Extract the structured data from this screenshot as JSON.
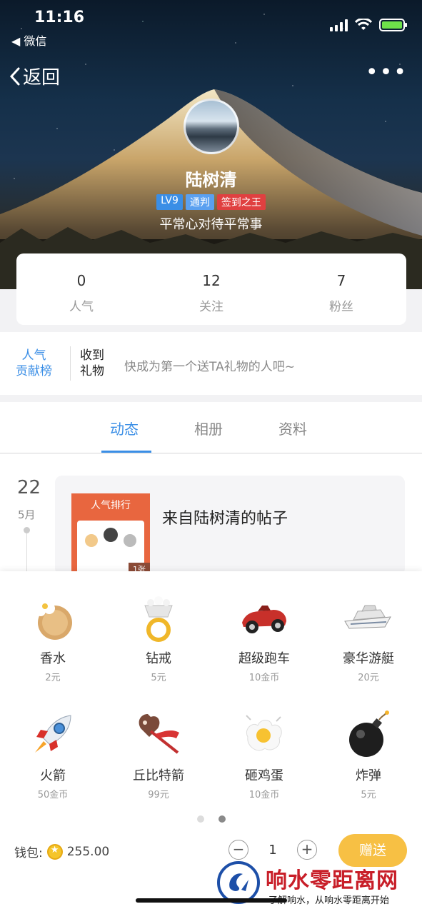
{
  "status": {
    "time": "11:16",
    "back_app": "◀ 微信"
  },
  "nav": {
    "back_label": "返回",
    "more_icon": "more-dots-icon"
  },
  "profile": {
    "name": "陆树清",
    "badges": [
      {
        "text": "LV9",
        "color": "#3a8ee6"
      },
      {
        "text": "通判",
        "color": "#5aa0f0"
      },
      {
        "text": "签到之王",
        "color": "#e04040"
      }
    ],
    "motto": "平常心对待平常事"
  },
  "stats": [
    {
      "value": "0",
      "label": "人气"
    },
    {
      "value": "12",
      "label": "关注"
    },
    {
      "value": "7",
      "label": "粉丝"
    }
  ],
  "gift_strip": {
    "rank_line1": "人气",
    "rank_line2": "贡献榜",
    "recv_line1": "收到",
    "recv_line2": "礼物",
    "hint": "快成为第一个送TA礼物的人吧~"
  },
  "tabs": [
    {
      "label": "动态",
      "active": true
    },
    {
      "label": "相册",
      "active": false
    },
    {
      "label": "资料",
      "active": false
    }
  ],
  "feed": {
    "day": "22",
    "month": "5月",
    "thumb_title": "人气排行",
    "thumb_tag": "1张",
    "post_title": "来自陆树清的帖子"
  },
  "gifts": [
    {
      "name": "香水",
      "price": "2元",
      "icon": "perfume-icon"
    },
    {
      "name": "钻戒",
      "price": "5元",
      "icon": "diamond-ring-icon"
    },
    {
      "name": "超级跑车",
      "price": "10金币",
      "icon": "race-car-icon"
    },
    {
      "name": "豪华游艇",
      "price": "20元",
      "icon": "yacht-icon"
    },
    {
      "name": "火箭",
      "price": "50金币",
      "icon": "rocket-icon"
    },
    {
      "name": "丘比特箭",
      "price": "99元",
      "icon": "cupid-arrow-icon"
    },
    {
      "name": "砸鸡蛋",
      "price": "10金币",
      "icon": "egg-icon"
    },
    {
      "name": "炸弹",
      "price": "5元",
      "icon": "bomb-icon"
    }
  ],
  "pager": {
    "pages": 2,
    "current": 2
  },
  "wallet": {
    "label": "钱包:",
    "amount": "255.00"
  },
  "stepper": {
    "minus": "−",
    "qty": "1",
    "plus": "+"
  },
  "send_label": "赠送",
  "watermark": {
    "title": "响水零距离网",
    "subtitle": "了解响水，从响水零距离开始"
  },
  "colors": {
    "accent": "#3a8ee6",
    "send": "#f7c044"
  }
}
